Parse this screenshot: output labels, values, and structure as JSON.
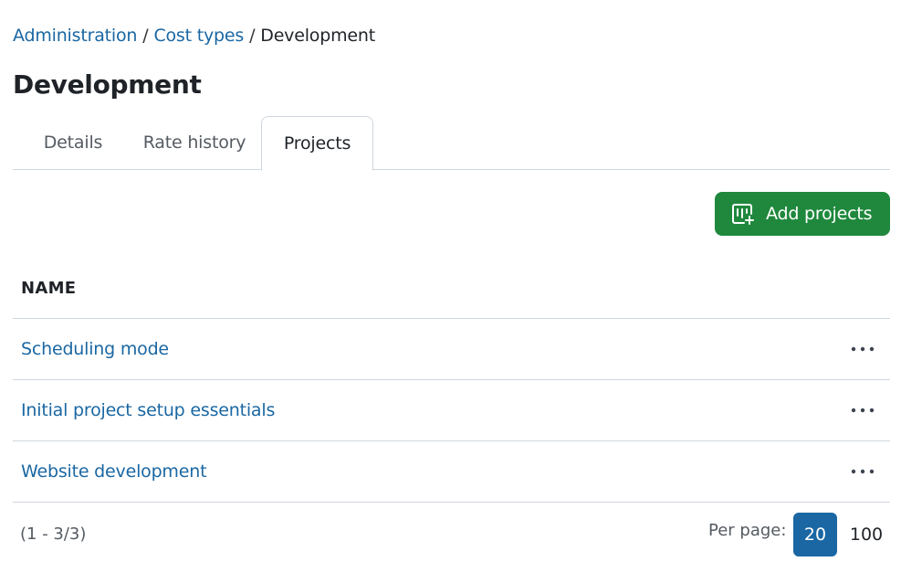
{
  "breadcrumb": {
    "items": [
      "Administration",
      "Cost types"
    ],
    "separator": "/",
    "current": "Development"
  },
  "page": {
    "title": "Development"
  },
  "tabs": [
    {
      "label": "Details"
    },
    {
      "label": "Rate history"
    },
    {
      "label": "Projects",
      "active": true
    }
  ],
  "toolbar": {
    "add_label": "Add projects",
    "add_icon": "project-add-icon"
  },
  "table": {
    "header": "NAME",
    "rows": [
      {
        "name": "Scheduling mode"
      },
      {
        "name": "Initial project setup essentials"
      },
      {
        "name": "Website development"
      }
    ]
  },
  "pagination": {
    "range": "(1 - 3/3)",
    "per_page_label": "Per page:",
    "options": [
      "20",
      "100"
    ],
    "selected": "20"
  },
  "colors": {
    "link": "#1a67a3",
    "primary_button": "#1f883d",
    "selected_page": "#1a67a3",
    "border": "#d0d7de"
  }
}
